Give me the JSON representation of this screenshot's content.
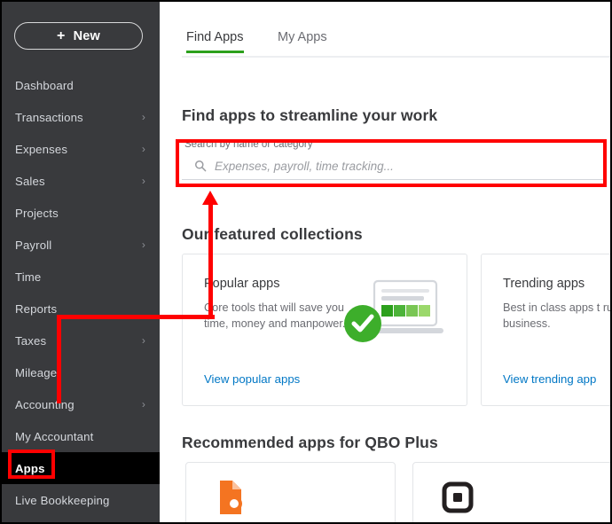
{
  "sidebar": {
    "new_button": {
      "label": "New",
      "plus": "+"
    },
    "items": [
      {
        "label": "Dashboard",
        "chevron": false,
        "active": false
      },
      {
        "label": "Transactions",
        "chevron": true,
        "active": false
      },
      {
        "label": "Expenses",
        "chevron": true,
        "active": false
      },
      {
        "label": "Sales",
        "chevron": true,
        "active": false
      },
      {
        "label": "Projects",
        "chevron": false,
        "active": false
      },
      {
        "label": "Payroll",
        "chevron": true,
        "active": false
      },
      {
        "label": "Time",
        "chevron": false,
        "active": false
      },
      {
        "label": "Reports",
        "chevron": false,
        "active": false
      },
      {
        "label": "Taxes",
        "chevron": true,
        "active": false
      },
      {
        "label": "Mileage",
        "chevron": false,
        "active": false
      },
      {
        "label": "Accounting",
        "chevron": true,
        "active": false
      },
      {
        "label": "My Accountant",
        "chevron": false,
        "active": false
      },
      {
        "label": "Apps",
        "chevron": false,
        "active": true
      },
      {
        "label": "Live Bookkeeping",
        "chevron": false,
        "active": false
      }
    ],
    "chevron_glyph": "›"
  },
  "main": {
    "tabs": [
      {
        "label": "Find Apps",
        "active": true
      },
      {
        "label": "My Apps",
        "active": false
      }
    ],
    "find_title": "Find apps to streamline your work",
    "search": {
      "label": "Search by name or category",
      "placeholder": "Expenses, payroll, time tracking...",
      "value": "",
      "icon": "search-icon"
    },
    "collections_title": "Our featured collections",
    "cards": [
      {
        "title": "Popular apps",
        "description": "Core tools that will save you time, money and manpower.",
        "link": "View popular apps",
        "art": "laptop-with-check-icon"
      },
      {
        "title": "Trending apps",
        "description": "Best in class apps t run your business.",
        "link": "View trending app",
        "art": "none"
      }
    ],
    "recommended_title": "Recommended apps for QBO Plus",
    "recommended_apps": [
      {
        "logo": "bill-dot-com-icon"
      },
      {
        "logo": "square-icon"
      }
    ]
  },
  "colors": {
    "sidebar_bg": "#393A3D",
    "sidebar_active_bg": "#000000",
    "accent_green": "#2CA01C",
    "link_blue": "#0077C5",
    "annotation_red": "#FF0000",
    "bill_orange": "#F47421"
  },
  "annotations": {
    "search_highlight": "red-rectangle-around-search-field",
    "apps_highlight": "red-rectangle-around-apps-nav-item",
    "connector": "red-arrow-from-apps-to-search"
  }
}
